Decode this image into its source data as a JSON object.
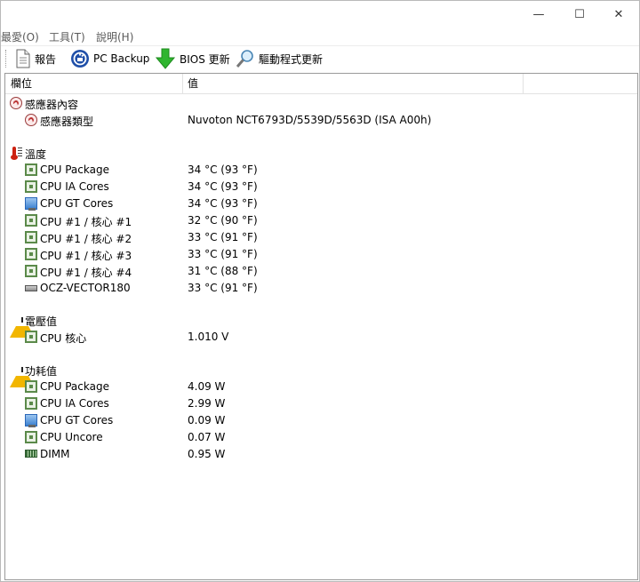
{
  "window": {
    "controls": {
      "minimize": "—",
      "maximize": "☐",
      "close": "✕"
    }
  },
  "menu": [
    {
      "label": "最愛(O)"
    },
    {
      "label": "工具(T)"
    },
    {
      "label": "說明(H)"
    }
  ],
  "toolbar": {
    "report_label": "報告",
    "backup_label": "PC Backup",
    "bios_label": "BIOS 更新",
    "driver_label": "驅動程式更新"
  },
  "columns": {
    "field": "欄位",
    "value": "值"
  },
  "rows": [
    {
      "field": "感應器內容",
      "value": ""
    },
    {
      "field": "感應器類型",
      "value": "Nuvoton NCT6793D/5539D/5563D  (ISA A00h)"
    },
    {
      "field": "溫度",
      "value": ""
    },
    {
      "field": "CPU Package",
      "value": "34 °C  (93 °F)"
    },
    {
      "field": "CPU IA Cores",
      "value": "34 °C  (93 °F)"
    },
    {
      "field": "CPU GT Cores",
      "value": "34 °C  (93 °F)"
    },
    {
      "field": "CPU #1 / 核心 #1",
      "value": "32 °C  (90 °F)"
    },
    {
      "field": "CPU #1 / 核心 #2",
      "value": "33 °C  (91 °F)"
    },
    {
      "field": "CPU #1 / 核心 #3",
      "value": "33 °C  (91 °F)"
    },
    {
      "field": "CPU #1 / 核心 #4",
      "value": "31 °C  (88 °F)"
    },
    {
      "field": "OCZ-VECTOR180",
      "value": "33 °C  (91 °F)"
    },
    {
      "field": "電壓值",
      "value": ""
    },
    {
      "field": "CPU 核心",
      "value": "1.010 V"
    },
    {
      "field": "功耗值",
      "value": ""
    },
    {
      "field": "CPU Package",
      "value": "4.09 W"
    },
    {
      "field": "CPU IA Cores",
      "value": "2.99 W"
    },
    {
      "field": "CPU GT Cores",
      "value": "0.09 W"
    },
    {
      "field": "CPU Uncore",
      "value": "0.07 W"
    },
    {
      "field": "DIMM",
      "value": "0.95 W"
    }
  ],
  "icons": {
    "report": "document-icon",
    "backup": "backup-icon",
    "bios": "down-arrow-icon",
    "driver": "magnifier-icon",
    "sensor": "sensor-icon",
    "temperature": "thermometer-icon",
    "voltage": "warning-icon",
    "power": "warning-icon",
    "cpu": "chip-icon",
    "gpu": "gpu-icon",
    "disk": "drive-icon",
    "memory": "dimm-icon"
  },
  "colors": {
    "chip_green": "#5b8a4a",
    "warning_yellow": "#f2b600",
    "thermometer_red": "#cc2211",
    "backup_blue": "#1f4fa8",
    "arrow_green": "#2fb52f"
  }
}
